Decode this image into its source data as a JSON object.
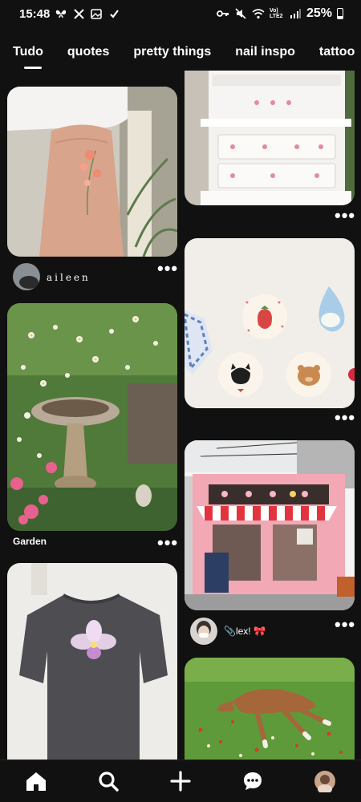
{
  "status_bar": {
    "time": "15:48",
    "battery": "25%",
    "network": "Vo) LTE2"
  },
  "tabs": [
    {
      "label": "Tudo",
      "active": true
    },
    {
      "label": "quotes",
      "active": false
    },
    {
      "label": "pretty things",
      "active": false
    },
    {
      "label": "nail inspo",
      "active": false
    },
    {
      "label": "tattoo",
      "active": false
    }
  ],
  "pins": {
    "tattoo_arm": {
      "user": "aileen"
    },
    "garden": {
      "title": "Garden"
    },
    "shop": {
      "user": "📎lex! 🎀"
    }
  },
  "colors": {
    "background": "#111111",
    "text": "#ffffff"
  },
  "icons": [
    "home-icon",
    "search-icon",
    "plus-icon",
    "chat-icon",
    "profile-avatar"
  ]
}
